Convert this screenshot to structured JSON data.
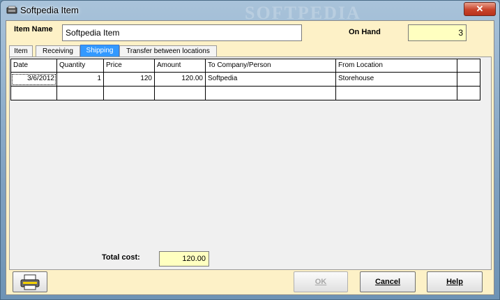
{
  "window": {
    "title": "Softpedia Item",
    "watermark": "SOFTPEDIA",
    "close_label": "✕"
  },
  "form": {
    "item_name_label": "Item Name",
    "item_name_value": "Softpedia Item",
    "on_hand_label": "On Hand",
    "on_hand_value": "3"
  },
  "tabs": [
    {
      "label": "Item"
    },
    {
      "label": "Receiving"
    },
    {
      "label": "Shipping",
      "active": true
    },
    {
      "label": "Transfer between  locations"
    }
  ],
  "table": {
    "columns": [
      "Date",
      "Quantity",
      "Price",
      "Amount",
      "To Company/Person",
      "From Location",
      ""
    ],
    "rows": [
      [
        "3/6/2012",
        "1",
        "120",
        "120.00",
        "Softpedia",
        "Storehouse",
        ""
      ],
      [
        "",
        "",
        "",
        "",
        "",
        "",
        ""
      ]
    ]
  },
  "totals": {
    "label": "Total cost:",
    "value": "120.00"
  },
  "buttons": {
    "ok": "OK",
    "cancel": "Cancel",
    "help": "Help"
  },
  "icons": {
    "title": "app-icon",
    "printer": "printer-icon"
  }
}
